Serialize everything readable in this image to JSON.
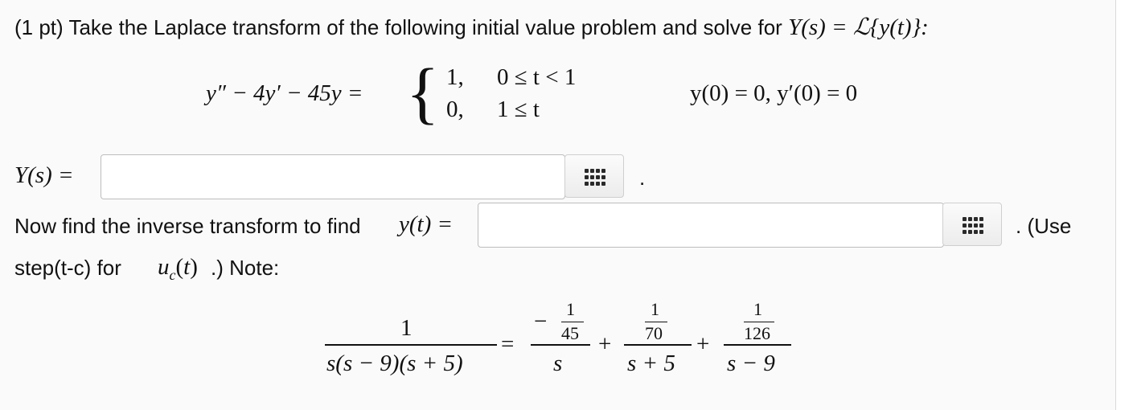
{
  "problem": {
    "prefix": "(1 pt) Take the Laplace transform of the following initial value problem and solve for",
    "Y_def": "Y(s) = ℒ{y(t)}:",
    "ode_lhs": "y″ − 4y′ − 45y =",
    "case1_val": "1,",
    "case1_cond": "0 ≤ t < 1",
    "case2_val": "0,",
    "case2_cond": "1 ≤ t",
    "initial_conditions": "y(0) = 0,  y′(0) = 0"
  },
  "answer1": {
    "label": "Y(s) =",
    "value": "",
    "trailing": "."
  },
  "answer2": {
    "label_text": "Now find the inverse transform to find",
    "label_math": "y(t) =",
    "value": "",
    "trailing": ". (Use",
    "note_line_a": "step(t-c) for",
    "note_math": "u",
    "note_sub": "c",
    "note_math_after": "(t)",
    "note_line_b": ".) Note:"
  },
  "partial_fractions": {
    "lhs_num": "1",
    "lhs_den": "s(s − 9)(s + 5)",
    "eq": "=",
    "t1_sign": "−",
    "t1_num": "1",
    "t1_den_inner": "45",
    "t1_den": "s",
    "plus1": "+",
    "t2_num": "1",
    "t2_den_inner": "70",
    "t2_den": "s + 5",
    "plus2": "+",
    "t3_num": "1",
    "t3_den_inner": "126",
    "t3_den": "s − 9"
  },
  "icons": {
    "palette": "equation-palette-icon"
  }
}
